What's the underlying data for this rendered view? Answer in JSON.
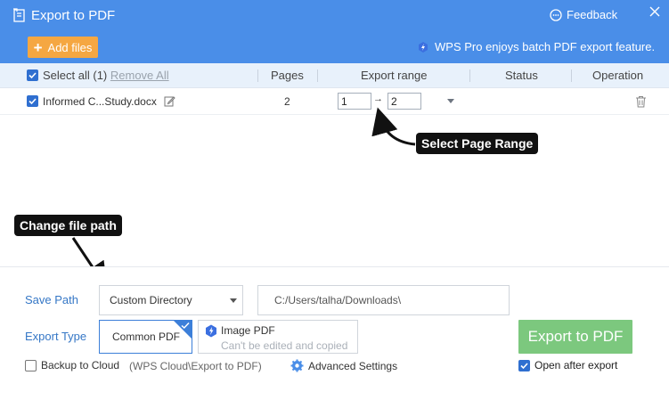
{
  "header": {
    "title": "Export to PDF",
    "feedback_label": "Feedback",
    "add_files_label": "Add files",
    "pro_note": "WPS Pro enjoys batch PDF export feature.",
    "bg_color": "#4a8ee8"
  },
  "table": {
    "select_all_label": "Select all (1)",
    "remove_all_label": "Remove All",
    "columns": {
      "pages": "Pages",
      "export_range": "Export range",
      "status": "Status",
      "operation": "Operation"
    },
    "rows": [
      {
        "checked": true,
        "file_name": "Informed C...Study.docx",
        "pages": "2",
        "range_from": "1",
        "range_to": "2",
        "status": ""
      }
    ]
  },
  "annotations": {
    "select_range": "Select Page Range",
    "change_path": "Change file path"
  },
  "bottom": {
    "save_path_label": "Save Path",
    "save_path_option": "Custom Directory",
    "save_path_value": "C:/Users/talha/Downloads\\",
    "export_type_label": "Export Type",
    "type_common": "Common PDF",
    "type_image_title": "Image PDF",
    "type_image_sub": "Can't be edited and copied",
    "export_button": "Export to PDF",
    "backup_label": "Backup to Cloud",
    "backup_checked": false,
    "backup_path": "(WPS Cloud\\Export to PDF)",
    "advanced_label": "Advanced Settings",
    "open_after_label": "Open after export",
    "open_after_checked": true,
    "export_color": "#7cc87e",
    "accent_color": "#3577c6"
  }
}
